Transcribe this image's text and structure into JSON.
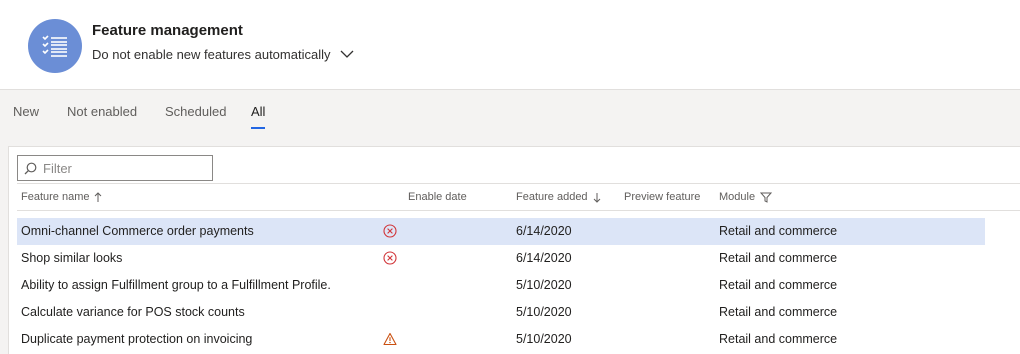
{
  "header": {
    "title": "Feature management",
    "subtitle": "Do not enable new features automatically",
    "accent_color": "#6b8ed6"
  },
  "tabs": [
    {
      "label": "New",
      "active": false
    },
    {
      "label": "Not enabled",
      "active": false
    },
    {
      "label": "Scheduled",
      "active": false
    },
    {
      "label": "All",
      "active": true
    }
  ],
  "filter": {
    "placeholder": "Filter",
    "value": ""
  },
  "columns": {
    "feature_name": "Feature name",
    "enable_date": "Enable date",
    "feature_added": "Feature added",
    "preview_feature": "Preview feature",
    "module": "Module"
  },
  "rows": [
    {
      "name": "Omni-channel Commerce order payments",
      "status_icon": "error-circle-icon",
      "enable_date": "",
      "feature_added": "6/14/2020",
      "preview": "",
      "module": "Retail and commerce",
      "selected": true
    },
    {
      "name": "Shop similar looks",
      "status_icon": "error-circle-icon",
      "enable_date": "",
      "feature_added": "6/14/2020",
      "preview": "",
      "module": "Retail and commerce",
      "selected": false
    },
    {
      "name": "Ability to assign Fulfillment group to a Fulfillment Profile.",
      "status_icon": "",
      "enable_date": "",
      "feature_added": "5/10/2020",
      "preview": "",
      "module": "Retail and commerce",
      "selected": false
    },
    {
      "name": "Calculate variance for POS stock counts",
      "status_icon": "",
      "enable_date": "",
      "feature_added": "5/10/2020",
      "preview": "",
      "module": "Retail and commerce",
      "selected": false
    },
    {
      "name": "Duplicate payment protection on invoicing",
      "status_icon": "warning-icon",
      "enable_date": "",
      "feature_added": "5/10/2020",
      "preview": "",
      "module": "Retail and commerce",
      "selected": false
    }
  ]
}
